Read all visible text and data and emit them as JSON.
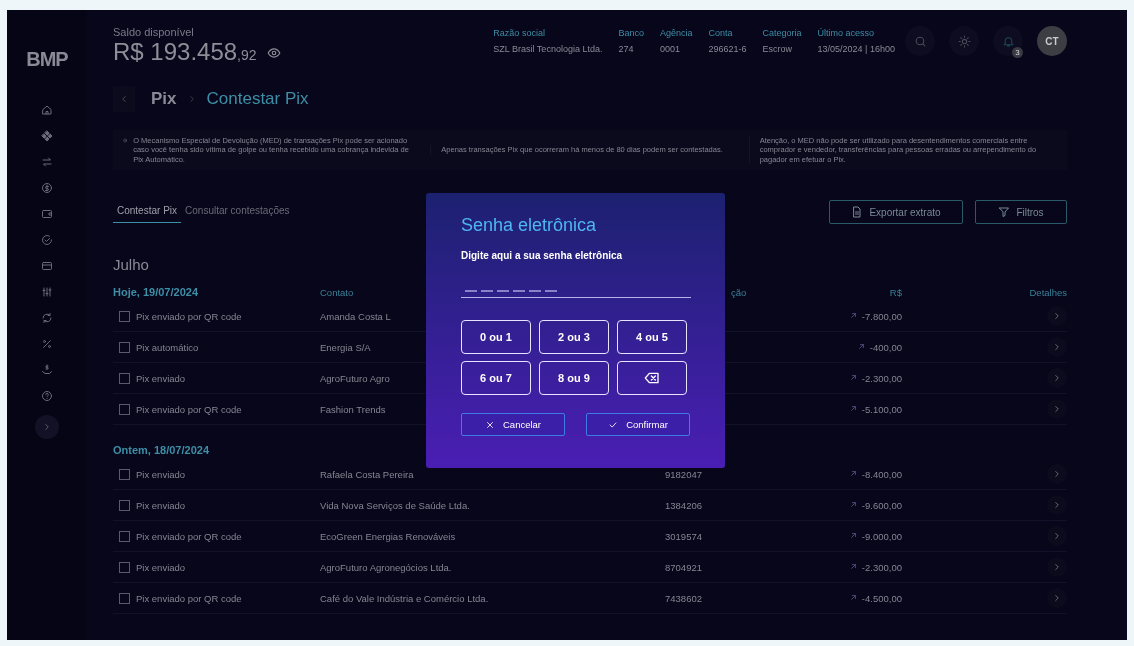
{
  "logo": "BMP",
  "header": {
    "balance_label": "Saldo disponível",
    "balance": "R$ 193.458",
    "balance_cents": ",92",
    "fields": [
      {
        "label": "Razão social",
        "value": "SZL Brasil Tecnologia Ltda."
      },
      {
        "label": "Banco",
        "value": "274"
      },
      {
        "label": "Agência",
        "value": "0001"
      },
      {
        "label": "Conta",
        "value": "296621-6"
      },
      {
        "label": "Categoria",
        "value": "Escrow"
      },
      {
        "label": "Último acesso",
        "value": "13/05/2024 | 16h00"
      }
    ],
    "notifications": "3",
    "avatar": "CT"
  },
  "breadcrumb": [
    "Pix",
    "Contestar Pix"
  ],
  "notes": [
    "O Mecanismo Especial de Devolução (MED) de  transações Pix pode ser acionado caso você tenha  sido vítima de golpe ou tenha recebido uma cobrança indevida de Pix Automático.",
    "Apenas transações Pix que ocorreram há menos de 80 dias podem ser contestadas.",
    "Atenção, o MED não pode ser utilizado para desentendimentos comerciais entre comprador e vendedor, transferências para pessoas erradas ou arrependimento do pagador em efetuar o Pix."
  ],
  "tabs": [
    {
      "label": "Contestar Pix",
      "selected": true
    },
    {
      "label": "Consultar contestações",
      "selected": false
    }
  ],
  "actions": [
    {
      "kind": "export",
      "label": "Exportar extrato"
    },
    {
      "kind": "filter",
      "label": "Filtros"
    }
  ],
  "month": "Julho",
  "columns": [
    "Contato",
    "ção",
    "R$",
    "Detalhes"
  ],
  "groups": [
    {
      "date": "Hoje, 19/07/2024",
      "rows": [
        {
          "type": "Pix enviado por QR code",
          "checked": false,
          "contact": "Amanda Costa L",
          "amount": "-7.800,00"
        },
        {
          "type": "Pix automático",
          "checked": false,
          "contact": "Energia S/A",
          "amount": "-400,00"
        },
        {
          "type": "Pix enviado",
          "checked": false,
          "contact": "AgroFuturo Agro",
          "amount": "-2.300,00"
        },
        {
          "type": "Pix enviado por QR code",
          "checked": false,
          "contact": "Fashion Trends",
          "amount": "-5.100,00"
        }
      ]
    },
    {
      "date": "Ontem, 18/07/2024",
      "rows": [
        {
          "type": "Pix enviado",
          "checked": false,
          "contact": "Rafaela Costa Pereira",
          "id": "9182047",
          "amount": "-8.400,00"
        },
        {
          "type": "Pix enviado",
          "checked": false,
          "contact": "Vida Nova Serviços de Saúde Ltda.",
          "id": "1384206",
          "amount": "-9.600,00"
        },
        {
          "type": "Pix enviado por QR code",
          "checked": false,
          "contact": "EcoGreen Energias Renováveis",
          "id": "3019574",
          "amount": "-9.000,00"
        },
        {
          "type": "Pix enviado",
          "checked": false,
          "contact": "AgroFuturo Agronegócios Ltda.",
          "id": "8704921",
          "amount": "-2.300,00"
        },
        {
          "type": "Pix enviado por QR code",
          "checked": false,
          "contact": "Café do Vale Indústria e Comércio Ltda.",
          "id": "7438602",
          "amount": "-4.500,00"
        }
      ]
    }
  ],
  "modal": {
    "title": "Senha eletrônica",
    "prompt": "Digite aqui a sua senha eletrônica",
    "keys": [
      {
        "kind": "digits",
        "label": "0 ou 1"
      },
      {
        "kind": "digits",
        "label": "2 ou 3"
      },
      {
        "kind": "digits",
        "label": "4 ou 5"
      },
      {
        "kind": "digits",
        "label": "6 ou 7"
      },
      {
        "kind": "digits",
        "label": "8 ou 9"
      },
      {
        "kind": "backspace"
      }
    ],
    "cancel": "Cancelar",
    "confirm": "Confirmar"
  }
}
